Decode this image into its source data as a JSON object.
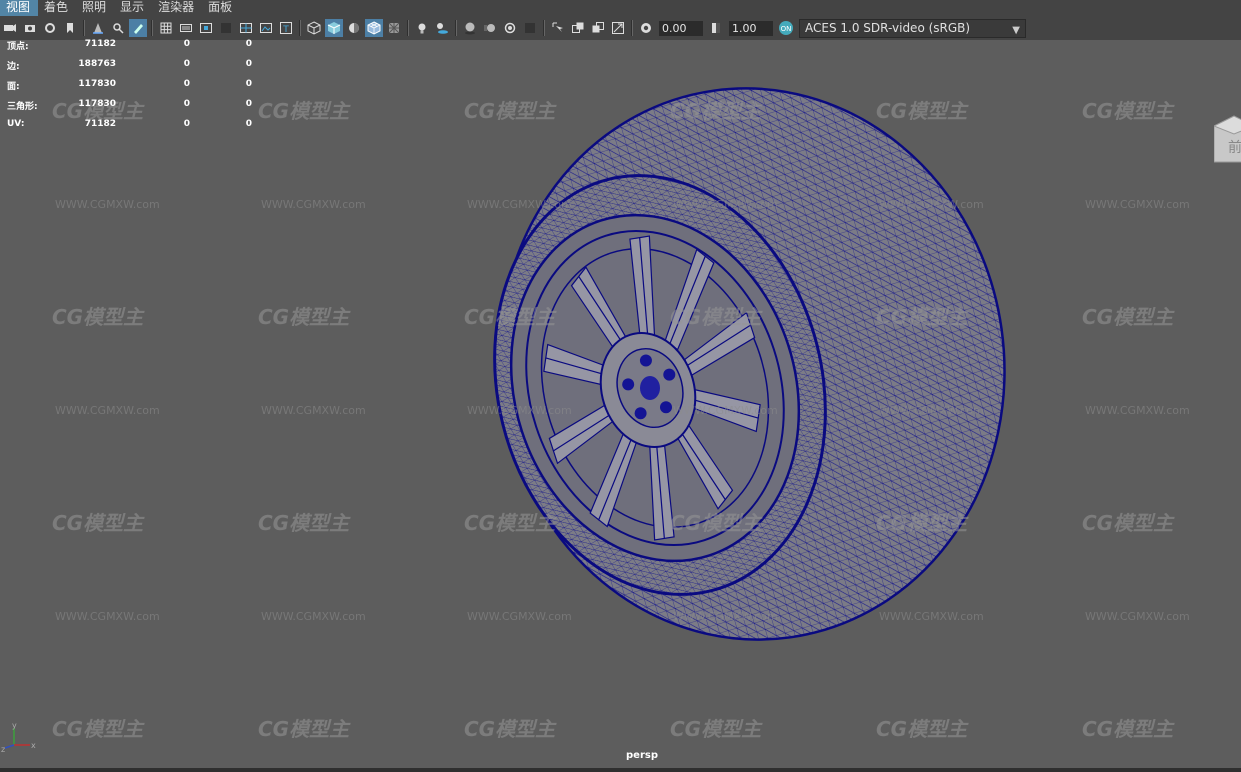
{
  "menu": {
    "items": [
      "视图",
      "着色",
      "照明",
      "显示",
      "渲染器",
      "面板"
    ]
  },
  "toolbar": {
    "gamma_value": "0.00",
    "exposure_value": "1.00",
    "color_space": "ACES 1.0 SDR-video (sRGB)",
    "icons": [
      "select-camera-icon",
      "camera-attributes-icon",
      "bookmark-icon",
      "image-plane-icon",
      "2d-pan-zoom-icon",
      "grease-pencil-icon",
      "grid-icon",
      "film-gate-icon",
      "resolution-gate-icon",
      "gate-mask-icon",
      "field-chart-icon",
      "safe-action-icon",
      "safe-title-icon",
      "wireframe-icon",
      "smooth-shade-icon",
      "default-material-icon",
      "wireframe-on-shaded-icon",
      "xray-icon",
      "use-all-lights-icon",
      "shadows-icon",
      "ambient-occlusion-icon",
      "motion-blur-icon",
      "multisample-aa-icon",
      "depth-of-field-icon",
      "isolate-select-icon",
      "xray-joints-icon",
      "xray-active-icon",
      "backface-culling-icon",
      "gamma-icon",
      "exposure-icon",
      "color-management-icon"
    ]
  },
  "hud": {
    "rows": [
      {
        "label": "顶点:",
        "v1": "71182",
        "v2": "0",
        "v3": "0"
      },
      {
        "label": "边:",
        "v1": "188763",
        "v2": "0",
        "v3": "0"
      },
      {
        "label": "面:",
        "v1": "117830",
        "v2": "0",
        "v3": "0"
      },
      {
        "label": "三角形:",
        "v1": "117830",
        "v2": "0",
        "v3": "0"
      },
      {
        "label": "UV:",
        "v1": "71182",
        "v2": "0",
        "v3": "0"
      }
    ]
  },
  "viewport": {
    "camera": "persp",
    "view_cube_face": "前",
    "watermark_logo": "CG模型主",
    "watermark_url": "WWW.CGMXW.com",
    "background_color": "#5d5d5d",
    "wire_color": "#0a0a8a"
  },
  "axis": {
    "x": "x",
    "y": "y",
    "z": "z"
  }
}
